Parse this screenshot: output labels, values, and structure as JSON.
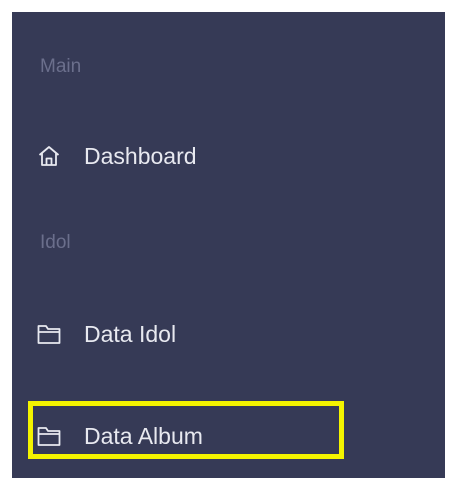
{
  "sidebar": {
    "sections": [
      {
        "label": "Main"
      },
      {
        "label": "Idol"
      }
    ],
    "items": [
      {
        "label": "Dashboard",
        "icon": "home-icon"
      },
      {
        "label": "Data Idol",
        "icon": "folder-icon"
      },
      {
        "label": "Data Album",
        "icon": "folder-icon",
        "highlighted": true
      }
    ]
  },
  "colors": {
    "sidebar_bg": "#363a56",
    "section_label": "#6b6f8c",
    "item_text": "#e8e9f0",
    "highlight": "#f4f400"
  }
}
